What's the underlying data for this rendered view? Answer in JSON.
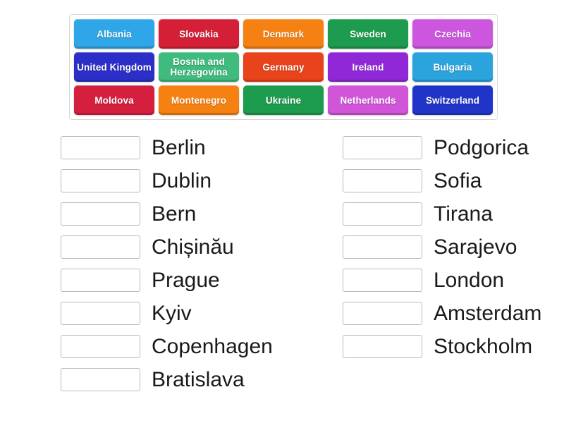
{
  "word_bank": {
    "rows": [
      [
        {
          "label": "Albania",
          "color": "#2ea6e8"
        },
        {
          "label": "Slovakia",
          "color": "#d41f36"
        },
        {
          "label": "Denmark",
          "color": "#f58112"
        },
        {
          "label": "Sweden",
          "color": "#1d9b4e"
        },
        {
          "label": "Czechia",
          "color": "#cc56de"
        }
      ],
      [
        {
          "label": "United Kingdom",
          "color": "#2b2fc8"
        },
        {
          "label": "Bosnia and Herzegovina",
          "color": "#3fbb7d"
        },
        {
          "label": "Germany",
          "color": "#e8431a"
        },
        {
          "label": "Ireland",
          "color": "#9128d8"
        },
        {
          "label": "Bulgaria",
          "color": "#2ba3dd"
        }
      ],
      [
        {
          "label": "Moldova",
          "color": "#d41f3f"
        },
        {
          "label": "Montenegro",
          "color": "#f58112"
        },
        {
          "label": "Ukraine",
          "color": "#1d9b4e"
        },
        {
          "label": "Netherlands",
          "color": "#d055d8"
        },
        {
          "label": "Switzerland",
          "color": "#2035c8"
        }
      ]
    ]
  },
  "answers": {
    "left_column": [
      {
        "value": "",
        "label": "Berlin"
      },
      {
        "value": "",
        "label": "Dublin"
      },
      {
        "value": "",
        "label": "Bern"
      },
      {
        "value": "",
        "label": "Chișinău"
      },
      {
        "value": "",
        "label": "Prague"
      },
      {
        "value": "",
        "label": "Kyiv"
      },
      {
        "value": "",
        "label": "Copenhagen"
      },
      {
        "value": "",
        "label": "Bratislava"
      }
    ],
    "right_column": [
      {
        "value": "",
        "label": "Podgorica"
      },
      {
        "value": "",
        "label": "Sofia"
      },
      {
        "value": "",
        "label": "Tirana"
      },
      {
        "value": "",
        "label": "Sarajevo"
      },
      {
        "value": "",
        "label": "London"
      },
      {
        "value": "",
        "label": "Amsterdam"
      },
      {
        "value": "",
        "label": "Stockholm"
      }
    ]
  }
}
